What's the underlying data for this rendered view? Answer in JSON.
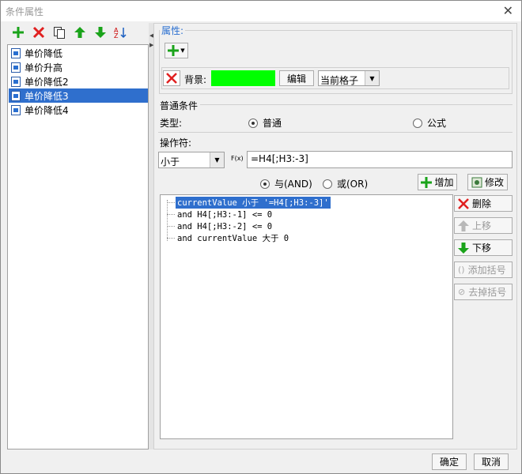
{
  "window": {
    "title": "条件属性"
  },
  "list": {
    "items": [
      {
        "label": "单价降低"
      },
      {
        "label": "单价升高"
      },
      {
        "label": "单价降低2"
      },
      {
        "label": "单价降低3"
      },
      {
        "label": "单价降低4"
      }
    ],
    "selected_index": 3
  },
  "attributes": {
    "group_label": "属性:",
    "background_label": "背景:",
    "background_color": "#00ff00",
    "edit_button": "编辑",
    "scope_value": "当前格子"
  },
  "condition": {
    "group_label": "普通条件",
    "type_label": "类型:",
    "type_options": [
      "普通",
      "公式"
    ],
    "type_selected": "普通",
    "operator_label": "操作符:",
    "operator_value": "小于",
    "fx_label": "F(x)",
    "formula_value": "=H4[;H3:-3]",
    "logic_options": [
      "与(AND)",
      "或(OR)"
    ],
    "logic_selected": "与(AND)",
    "add_button": "增加",
    "modify_button": "修改"
  },
  "tree": {
    "lines": [
      "currentValue 小于 '=H4[;H3:-3]'",
      "and H4[;H3:-1] <= 0",
      "and H4[;H3:-2] <= 0",
      "and currentValue 大于 0"
    ],
    "selected_index": 0
  },
  "side_buttons": {
    "delete": "删除",
    "move_up": "上移",
    "move_down": "下移",
    "add_bracket": "添加括号",
    "remove_bracket": "去掉括号"
  },
  "footer": {
    "ok": "确定",
    "cancel": "取消"
  },
  "colors": {
    "add_green": "#1aa31a",
    "delete_red": "#e02020",
    "selection_blue": "#2f6fcd"
  }
}
